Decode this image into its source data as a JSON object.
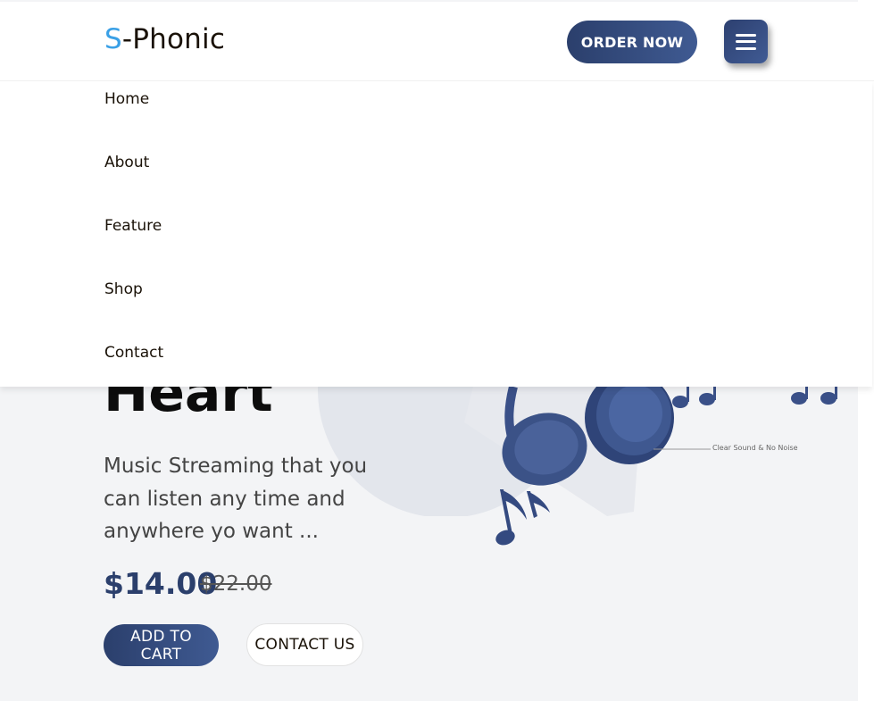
{
  "header": {
    "logo_initial": "S",
    "logo_rest": "-Phonic",
    "order_button": "ORDER NOW",
    "menu_icon": "hamburger-icon"
  },
  "nav": {
    "items": [
      "Home",
      "About",
      "Feature",
      "Shop",
      "Contact"
    ]
  },
  "hero": {
    "title_visible": "Heart",
    "description": "Music Streaming that you can listen any time and anywhere yo want ...",
    "price": "$14.00",
    "old_price": "$22.00",
    "add_to_cart": "ADD TO CART",
    "contact_us": "CONTACT US",
    "callout": "Clear Sound & No Noise",
    "image_icon": "headphones-icon",
    "note_icon": "music-note-icon"
  },
  "colors": {
    "brand_primary": "#2b3f6c",
    "logo_accent": "#3aa0e6",
    "hero_bg": "#f3f4f6"
  }
}
